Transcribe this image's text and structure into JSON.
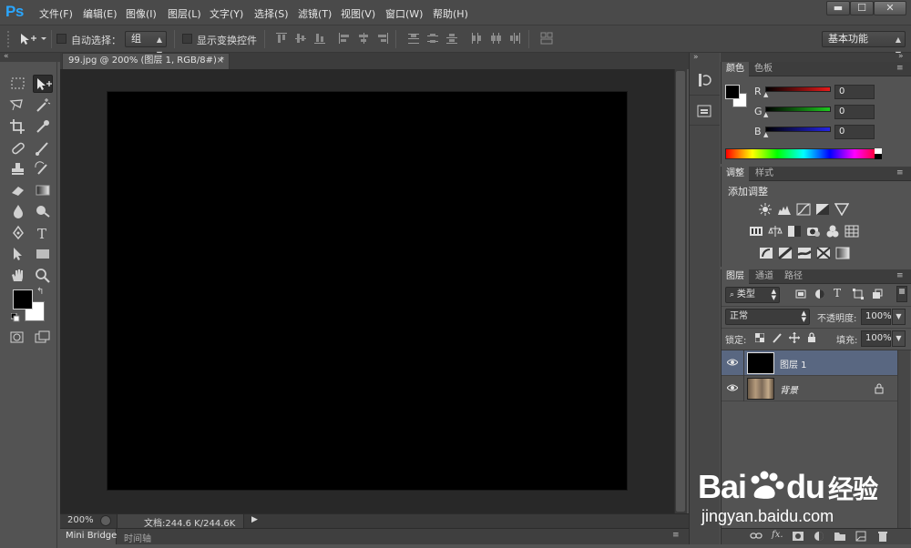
{
  "app": {
    "logo": "Ps"
  },
  "menu": [
    "文件(F)",
    "编辑(E)",
    "图像(I)",
    "图层(L)",
    "文字(Y)",
    "选择(S)",
    "滤镜(T)",
    "视图(V)",
    "窗口(W)",
    "帮助(H)"
  ],
  "window_controls": {
    "minimize": "▬",
    "maximize": "☐",
    "close": "✕"
  },
  "options_bar": {
    "auto_select_label": "自动选择：",
    "auto_select_value": "组",
    "show_transform_label": "显示变换控件",
    "workspace": "基本功能"
  },
  "document": {
    "tab_title": "99.jpg @ 200% (图层 1, RGB/8#) *",
    "tab_close": "×",
    "zoom": "200%",
    "doc_size": "文档:244.6 K/244.6K"
  },
  "bottom_tabs": [
    "Mini Bridge",
    "时间轴"
  ],
  "color_panel": {
    "tabs": [
      "颜色",
      "色板"
    ],
    "channels": [
      {
        "label": "R",
        "value": "0",
        "color": "#e81a1a"
      },
      {
        "label": "G",
        "value": "0",
        "color": "#1ec81e"
      },
      {
        "label": "B",
        "value": "0",
        "color": "#2424e6"
      }
    ],
    "foreground": "#000000",
    "background": "#ffffff"
  },
  "adjustments_panel": {
    "tabs": [
      "调整",
      "样式"
    ],
    "title": "添加调整"
  },
  "layers_panel": {
    "tabs": [
      "图层",
      "通道",
      "路径"
    ],
    "filter_kind": "类型",
    "blend_mode": "正常",
    "opacity_label": "不透明度:",
    "opacity": "100%",
    "lock_label": "锁定:",
    "fill_label": "填充:",
    "fill": "100%",
    "layers": [
      {
        "name": "图层 1",
        "selected": true
      },
      {
        "name": "背景",
        "selected": false,
        "locked": true
      }
    ],
    "footer_icons": [
      "link-icon",
      "fx-icon",
      "mask-icon",
      "adjustment-layer-icon",
      "folder-icon",
      "new-layer-icon",
      "trash-icon"
    ]
  },
  "watermark": {
    "brand_left": "Bai",
    "brand_right": "du",
    "brand_cn": "经验",
    "url": "jingyan.baidu.com"
  }
}
